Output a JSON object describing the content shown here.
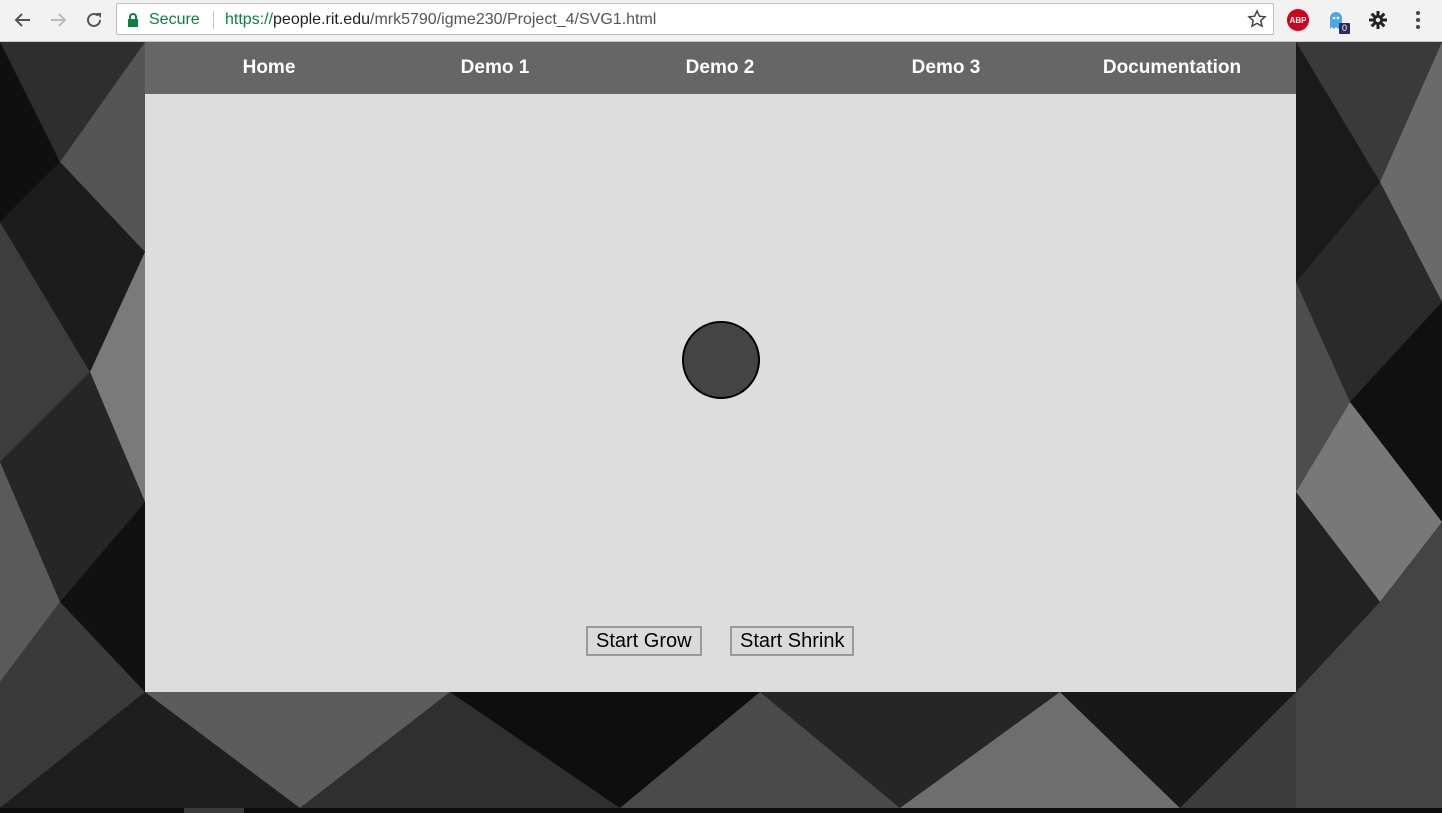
{
  "browser": {
    "secure_label": "Secure",
    "url_scheme": "https://",
    "url_host": "people.rit.edu",
    "url_path": "/mrk5790/igme230/Project_4/SVG1.html",
    "extensions": [
      {
        "name": "adblock-plus",
        "label": "ABP"
      },
      {
        "name": "ghostery",
        "badge": "0"
      }
    ]
  },
  "nav": {
    "items": [
      {
        "label": "Home"
      },
      {
        "label": "Demo 1"
      },
      {
        "label": "Demo 2"
      },
      {
        "label": "Demo 3"
      },
      {
        "label": "Documentation"
      }
    ]
  },
  "demo": {
    "grow_button": "Start Grow",
    "shrink_button": "Start Shrink"
  },
  "colors": {
    "nav_bg": "#666666",
    "stage_bg": "#dddddd",
    "circle_fill": "#444444",
    "secure_green": "#0b8043"
  },
  "icons": [
    "back-arrow-icon",
    "forward-arrow-icon",
    "reload-icon",
    "lock-icon",
    "star-icon",
    "gear-icon",
    "menu-dots-icon"
  ]
}
